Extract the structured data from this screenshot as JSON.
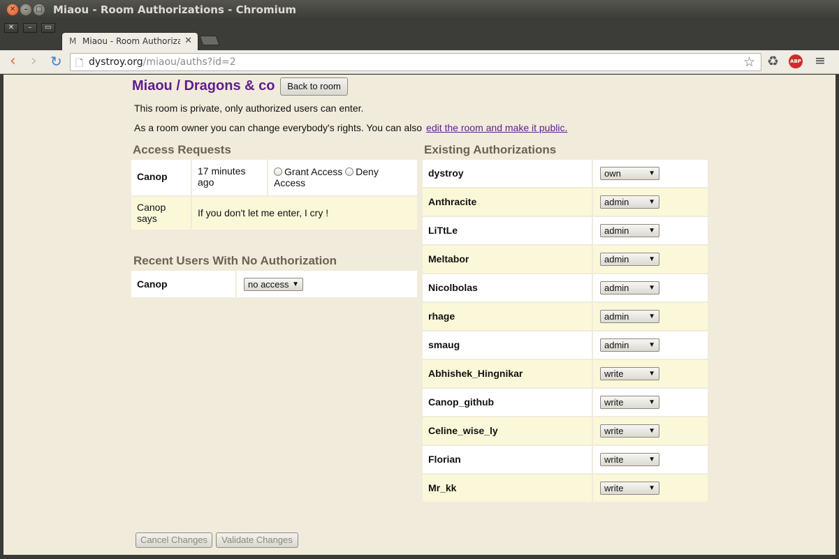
{
  "window": {
    "title": "Miaou - Room Authorizations - Chromium"
  },
  "tab": {
    "title": "Miaou - Room Authorizati",
    "favicon": "M"
  },
  "toolbar": {
    "url_host": "dystroy.org",
    "url_path": "/miaou/auths?id=2",
    "abp_label": "ABP"
  },
  "room": {
    "title": "Miaou / Dragons & co",
    "back_button": "Back to room",
    "private_text": "This room is private, only authorized users can enter.",
    "owner_text": "As a room owner you can change everybody's rights. You can also",
    "edit_link": "edit the room and make it public."
  },
  "access_requests": {
    "heading": "Access Requests",
    "user": "Canop",
    "time": "17 minutes ago",
    "grant_label": "Grant Access",
    "deny_label": "Deny Access",
    "says_label": "Canop says",
    "message": "If you don't let me enter, I cry !"
  },
  "recent_users": {
    "heading": "Recent Users With No Authorization",
    "rows": [
      {
        "name": "Canop",
        "level": "no access"
      }
    ]
  },
  "existing": {
    "heading": "Existing Authorizations",
    "rows": [
      {
        "name": "dystroy",
        "level": "own"
      },
      {
        "name": "Anthracite",
        "level": "admin"
      },
      {
        "name": "LiTtLe",
        "level": "admin"
      },
      {
        "name": "Meltabor",
        "level": "admin"
      },
      {
        "name": "Nicolbolas",
        "level": "admin"
      },
      {
        "name": "rhage",
        "level": "admin"
      },
      {
        "name": "smaug",
        "level": "admin"
      },
      {
        "name": "Abhishek_Hingnikar",
        "level": "write"
      },
      {
        "name": "Canop_github",
        "level": "write"
      },
      {
        "name": "Celine_wise_ly",
        "level": "write"
      },
      {
        "name": "Florian",
        "level": "write"
      },
      {
        "name": "Mr_kk",
        "level": "write"
      }
    ]
  },
  "footer": {
    "cancel": "Cancel Changes",
    "validate": "Validate Changes"
  }
}
